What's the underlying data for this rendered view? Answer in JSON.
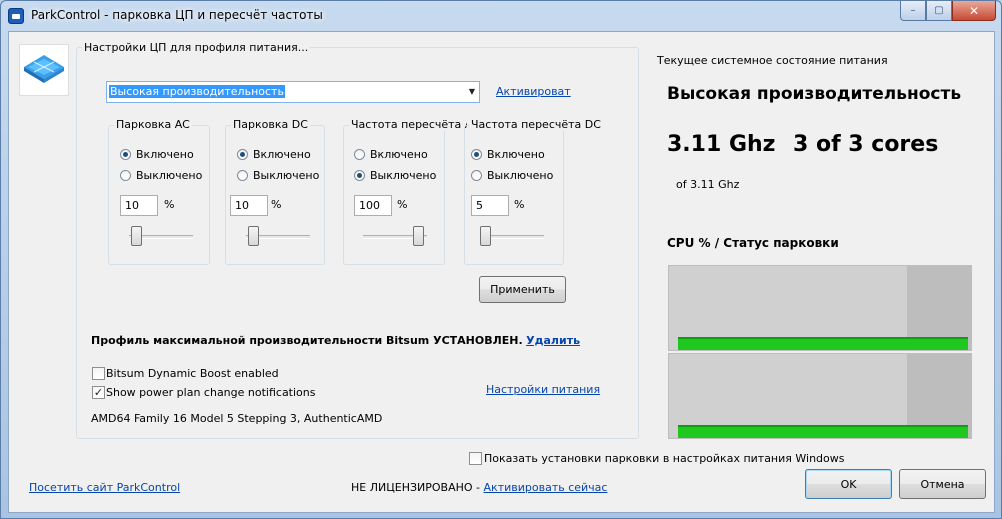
{
  "window": {
    "title": "ParkControl - парковка ЦП и пересчёт частоты",
    "close_glyph": "✕",
    "min_glyph": "–",
    "max_glyph": "▢"
  },
  "settings": {
    "group_label": "Настройки ЦП для профиля питания...",
    "profile_selected": "Высокая производительность",
    "activate_link": "Активироват",
    "apply_button": "Применить",
    "columns": [
      {
        "label": "Парковка AC",
        "on_label": "Включено",
        "off_label": "Выключено",
        "selected": "on",
        "value": "10",
        "unit": "%",
        "slider_fraction": 0.1
      },
      {
        "label": "Парковка DC",
        "on_label": "Включено",
        "off_label": "Выключено",
        "selected": "on",
        "value": "10",
        "unit": "%",
        "slider_fraction": 0.1
      },
      {
        "label": "Частота пересчёта AC",
        "on_label": "Включено",
        "off_label": "Выключено",
        "selected": "off",
        "value": "100",
        "unit": "%",
        "slider_fraction": 1.0
      },
      {
        "label": "Частота пересчёта DC",
        "on_label": "Включено",
        "off_label": "Выключено",
        "selected": "on",
        "value": "5",
        "unit": "%",
        "slider_fraction": 0.05
      }
    ],
    "bitsum_profile_text": "Профиль максимальной производительности Bitsum УСТАНОВЛЕН.",
    "remove_link": "Удалить",
    "dynamic_boost_label": "Bitsum Dynamic Boost enabled",
    "dynamic_boost_checked": false,
    "notifications_label": "Show power plan change notifications",
    "notifications_checked": true,
    "power_settings_link": "Настройки питания",
    "cpu_info": "AMD64 Family 16 Model 5 Stepping 3, AuthenticAMD"
  },
  "status": {
    "heading": "Текущее системное состояние питания",
    "plan_name": "Высокая производительность",
    "frequency": "3.11 Ghz",
    "cores": "3 of 3 cores",
    "of_frequency": "of 3.11 Ghz",
    "chart_title": "CPU % / Статус парковки",
    "core_usage_percent": [
      15,
      15
    ]
  },
  "footer": {
    "show_parking_label": "Показать установки парковки в настройках питания Windows",
    "show_parking_checked": false,
    "site_link": "Посетить сайт ParkControl",
    "unlicensed_text": "НЕ ЛИЦЕНЗИРОВАНО -",
    "activate_now_link": "Активировать сейчас",
    "ok_button": "OK",
    "cancel_button": "Отмена"
  },
  "colors": {
    "accent_link": "#0645ad",
    "selection": "#3399ff",
    "cpu_bar": "#1ec81e"
  }
}
